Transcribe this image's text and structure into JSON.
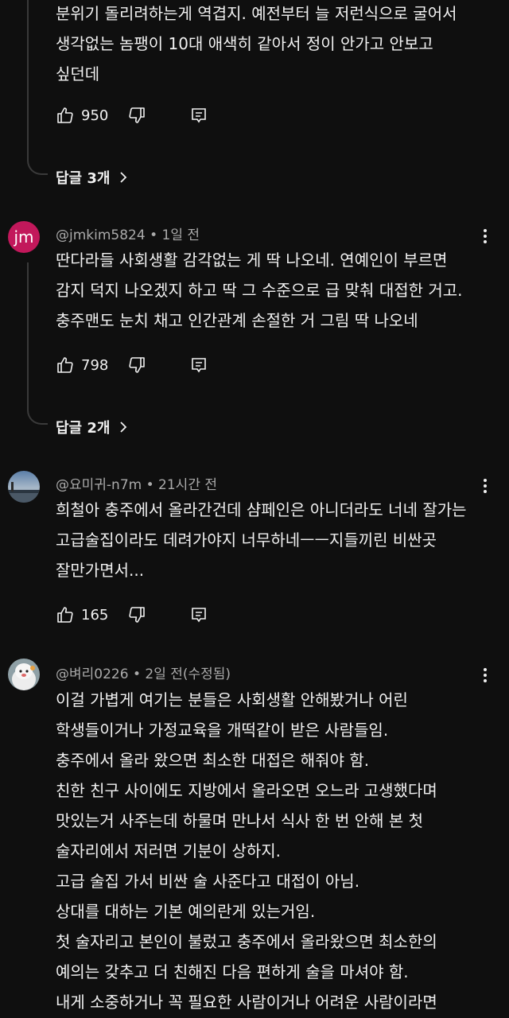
{
  "comment0": {
    "lines": [
      "분위기 돌리려하는게 역겹지. 예전부터 늘 저런식으로 굴어서",
      "생각없는 놈팽이 10대 애색히 같아서 정이 안가고 안보고",
      "싶던데"
    ],
    "likes": "950",
    "replies_label": "답글 3개"
  },
  "comment1": {
    "avatar_initials": "jm",
    "author": "@jmkim5824",
    "time": " • 1일 전",
    "lines": [
      "딴다라들 사회생활 감각없는 게 딱 나오네. 연예인이 부르면",
      "감지 덕지 나오겠지 하고 딱 그 수준으로 급 맞춰 대접한 거고.",
      "충주맨도 눈치 채고 인간관계 손절한 거 그림 딱 나오네"
    ],
    "likes": "798",
    "replies_label": "답글 2개"
  },
  "comment2": {
    "author": "@요미귀-n7m",
    "time": " • 21시간 전",
    "lines": [
      "희철아 충주에서 올라간건데 샴페인은 아니더라도 너네 잘가는",
      "고급술집이라도 데려가야지 너무하네ㅡㅡ지들끼린 비싼곳",
      "잘만가면서..."
    ],
    "likes": "165"
  },
  "comment3": {
    "author": "@벼리0226",
    "time": " • 2일 전(수정됨)",
    "lines": [
      "이걸 가볍게 여기는 분들은 사회생활 안해봤거나 어린",
      "학생들이거나 가정교육을 개떡같이 받은 사람들임.",
      "충주에서 올라 왔으면 최소한 대접은 해줘야 함.",
      "친한 친구 사이에도 지방에서 올라오면 오느라 고생했다며",
      "맛있는거 사주는데 하물며 만나서 식사 한 번 안해 본 첫",
      "술자리에서 저러면 기분이 상하지.",
      "고급 술집 가서 비싼 술 사준다고 대접이 아님.",
      "상대를 대하는 기본 예의란게 있는거임.",
      "첫 술자리고 본인이 불렀고 충주에서 올라왔으면 최소한의",
      "예의는 갖추고 더 친해진 다음 편하게 술을 마셔야 함.",
      "내게 소중하거나 꼭 필요한 사람이거나 어려운 사람이라면"
    ]
  },
  "icons": {
    "like": "thumbs-up-icon",
    "dislike": "thumbs-down-icon",
    "reply": "reply-icon",
    "menu": "more-vert-icon",
    "chevron": "chevron-right-icon"
  },
  "colors": {
    "background": "#0f0f0f",
    "text": "#f1f1f1",
    "meta": "#aaaaaa",
    "avatar_jm": "#c2185b"
  }
}
